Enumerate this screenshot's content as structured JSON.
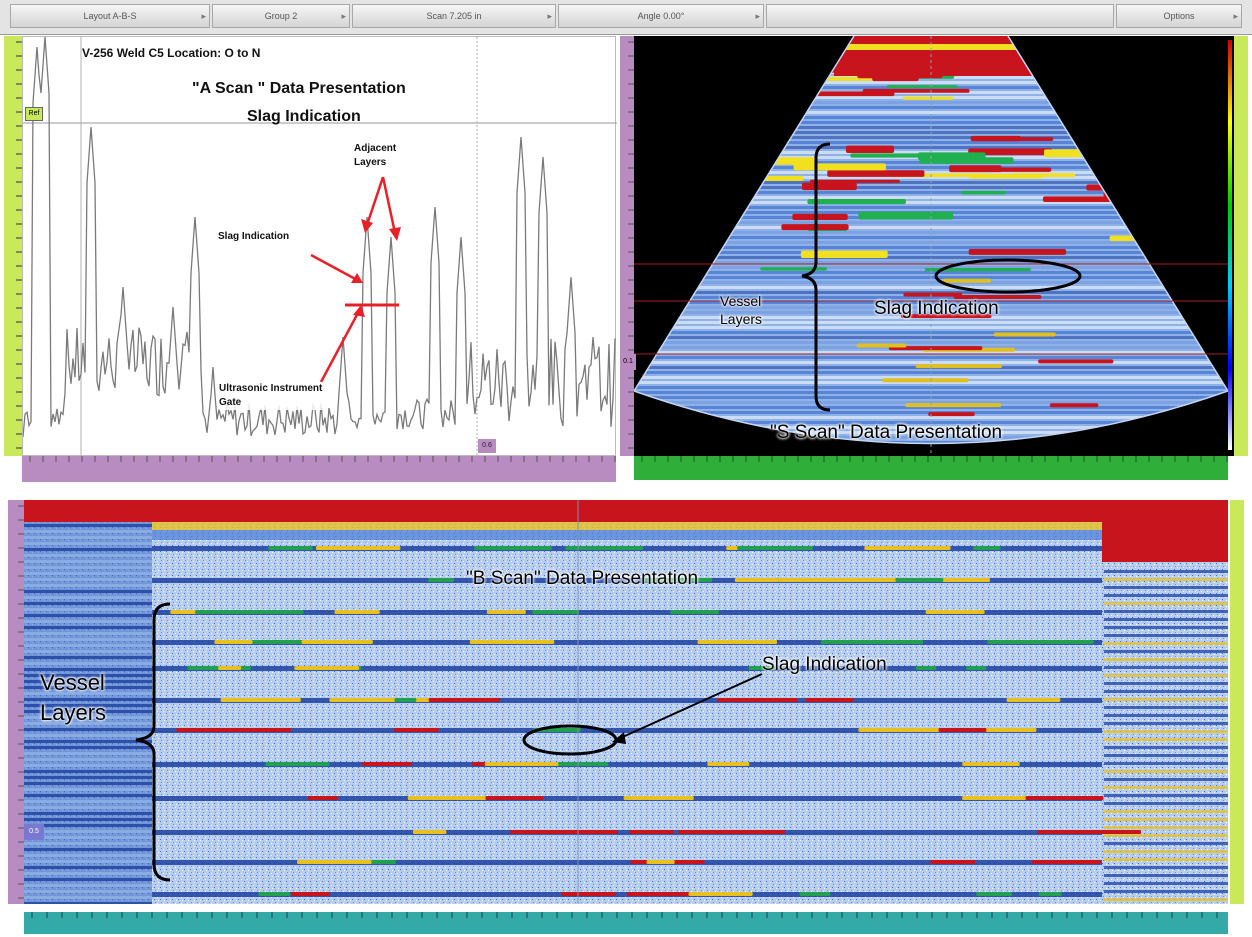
{
  "toolbar": {
    "layout_label": "Layout A-B-S",
    "group_label": "Group 2",
    "scan_label": "Scan 7.205 in",
    "angle_label": "Angle 0.00°",
    "options_label": "Options"
  },
  "a_scan": {
    "location_title": "V-256 Weld C5 Location: O to N",
    "heading_line1": "\"A Scan \" Data Presentation",
    "heading_line2": "Slag Indication",
    "adjacent_line1": "Adjacent",
    "adjacent_line2": "Layers",
    "slag_label": "Slag Indication",
    "gate_line1": "Ultrasonic Instrument",
    "gate_line2": "Gate",
    "ref_tag": "Ref",
    "cursor_tag": "0.6"
  },
  "s_scan": {
    "vessel_line1": "Vessel",
    "vessel_line2": "Layers",
    "slag_label": "Slag Indication",
    "heading": "\"S Scan\" Data Presentation",
    "left_tag": "0.1"
  },
  "b_scan": {
    "heading": "\"B Scan\" Data Presentation",
    "slag_label": "Slag Indication",
    "vessel_line1": "Vessel",
    "vessel_line2": "Layers",
    "left_tag": "0.5"
  },
  "colors": {
    "purple_ruler": "#b88cc0",
    "yellow_ruler": "#c9e85a",
    "green_ruler": "#2fae3a",
    "teal_ruler": "#33aaa8",
    "gate_red": "#e8202a",
    "scan_red": "#c8141c",
    "scan_blue": "#2a5fc8"
  }
}
